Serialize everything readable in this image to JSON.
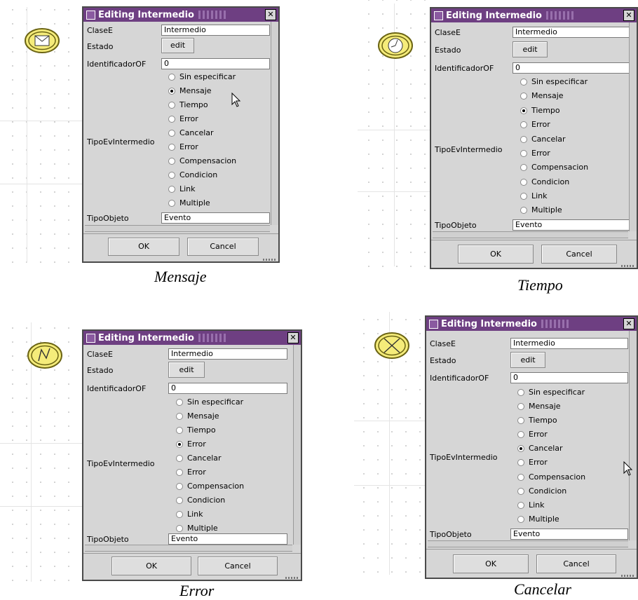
{
  "panels": [
    {
      "caption": "Mensaje",
      "icon": "envelope-icon",
      "dialog": {
        "title": "Editing Intermedio",
        "fields": {
          "clasee_label": "ClaseE",
          "clasee_value": "Intermedio",
          "estado_label": "Estado",
          "estado_button": "edit",
          "identificador_label": "IdentificadorOF",
          "identificador_value": "0",
          "tipoev_label": "TipoEvIntermedio",
          "tipoobjeto_label": "TipoObjeto",
          "tipoobjeto_value": "Evento"
        },
        "options": [
          "Sin especificar",
          "Mensaje",
          "Tiempo",
          "Error",
          "Cancelar",
          "Error",
          "Compensacion",
          "Condicion",
          "Link",
          "Multiple"
        ],
        "selected_index": 1,
        "ok_label": "OK",
        "cancel_label": "Cancel"
      }
    },
    {
      "caption": "Tiempo",
      "icon": "clock-icon",
      "dialog": {
        "title": "Editing Intermedio",
        "fields": {
          "clasee_label": "ClaseE",
          "clasee_value": "Intermedio",
          "estado_label": "Estado",
          "estado_button": "edit",
          "identificador_label": "IdentificadorOF",
          "identificador_value": "0",
          "tipoev_label": "TipoEvIntermedio",
          "tipoobjeto_label": "TipoObjeto",
          "tipoobjeto_value": "Evento"
        },
        "options": [
          "Sin especificar",
          "Mensaje",
          "Tiempo",
          "Error",
          "Cancelar",
          "Error",
          "Compensacion",
          "Condicion",
          "Link",
          "Multiple"
        ],
        "selected_index": 2,
        "ok_label": "OK",
        "cancel_label": "Cancel"
      }
    },
    {
      "caption": "Error",
      "icon": "lightning-icon",
      "dialog": {
        "title": "Editing Intermedio",
        "fields": {
          "clasee_label": "ClaseE",
          "clasee_value": "Intermedio",
          "estado_label": "Estado",
          "estado_button": "edit",
          "identificador_label": "IdentificadorOF",
          "identificador_value": "0",
          "tipoev_label": "TipoEvIntermedio",
          "tipoobjeto_label": "TipoObjeto",
          "tipoobjeto_value": "Evento"
        },
        "options": [
          "Sin especificar",
          "Mensaje",
          "Tiempo",
          "Error",
          "Cancelar",
          "Error",
          "Compensacion",
          "Condicion",
          "Link",
          "Multiple"
        ],
        "selected_index": 3,
        "ok_label": "OK",
        "cancel_label": "Cancel"
      }
    },
    {
      "caption": "Cancelar",
      "icon": "cancel-x-icon",
      "dialog": {
        "title": "Editing Intermedio",
        "fields": {
          "clasee_label": "ClaseE",
          "clasee_value": "Intermedio",
          "estado_label": "Estado",
          "estado_button": "edit",
          "identificador_label": "IdentificadorOF",
          "identificador_value": "0",
          "tipoev_label": "TipoEvIntermedio",
          "tipoobjeto_label": "TipoObjeto",
          "tipoobjeto_value": "Evento"
        },
        "options": [
          "Sin especificar",
          "Mensaje",
          "Tiempo",
          "Error",
          "Cancelar",
          "Error",
          "Compensacion",
          "Condicion",
          "Link",
          "Multiple"
        ],
        "selected_index": 4,
        "ok_label": "OK",
        "cancel_label": "Cancel"
      }
    }
  ],
  "colors": {
    "titlebar": "#6e3f82",
    "dialog_bg": "#d6d6d6",
    "event_fill": "#f5ec7a",
    "event_stroke": "#6b6414"
  }
}
